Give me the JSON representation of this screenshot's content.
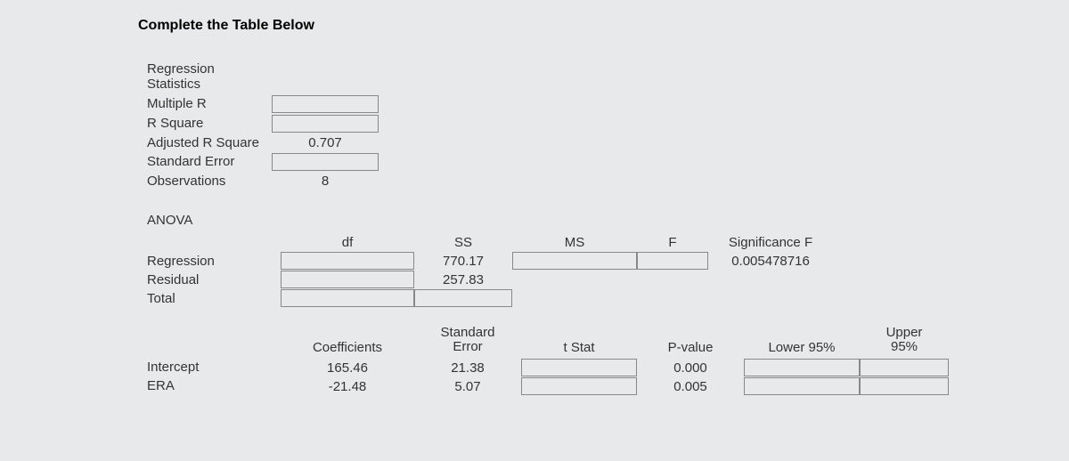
{
  "title": "Complete the Table Below",
  "stats": {
    "heading1": "Regression",
    "heading2": "Statistics",
    "rows": {
      "multiple_r": {
        "label": "Multiple R",
        "value": ""
      },
      "r_square": {
        "label": "R Square",
        "value": ""
      },
      "adj_r_square": {
        "label": "Adjusted R Square",
        "value": "0.707"
      },
      "std_error": {
        "label": "Standard Error",
        "value": ""
      },
      "observations": {
        "label": "Observations",
        "value": "8"
      }
    }
  },
  "anova": {
    "heading": "ANOVA",
    "headers": {
      "df": "df",
      "ss": "SS",
      "ms": "MS",
      "f": "F",
      "sig_f": "Significance F"
    },
    "rows": {
      "regression": {
        "label": "Regression",
        "df": "",
        "ss": "770.17",
        "ms": "",
        "f": "",
        "sig_f": "0.005478716"
      },
      "residual": {
        "label": "Residual",
        "df": "",
        "ss": "257.83"
      },
      "total": {
        "label": "Total",
        "df": "",
        "ss": ""
      }
    }
  },
  "coef": {
    "headers": {
      "coefficients": "Coefficients",
      "std_err1": "Standard",
      "std_err2": "Error",
      "t_stat": "t Stat",
      "p_value": "P-value",
      "lower95": "Lower 95%",
      "upper95_1": "Upper",
      "upper95_2": "95%"
    },
    "rows": {
      "intercept": {
        "label": "Intercept",
        "coef": "165.46",
        "se": "21.38",
        "t": "",
        "p": "0.000",
        "lower": "",
        "upper": ""
      },
      "era": {
        "label": "ERA",
        "coef": "-21.48",
        "se": "5.07",
        "t": "",
        "p": "0.005",
        "lower": "",
        "upper": ""
      }
    }
  }
}
